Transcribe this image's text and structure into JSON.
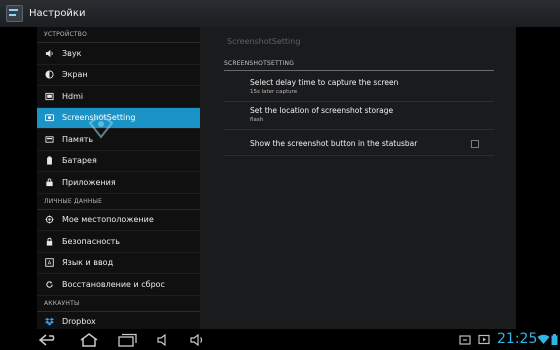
{
  "app": {
    "title": "Настройки",
    "icon": "settings-app-icon"
  },
  "sidebar": {
    "sections": [
      {
        "label": "УСТРОЙСТВО",
        "items": [
          {
            "label": "Звук",
            "icon": "volume-icon"
          },
          {
            "label": "Экран",
            "icon": "brightness-icon"
          },
          {
            "label": "Hdmi",
            "icon": "hdmi-icon"
          },
          {
            "label": "ScreenshotSetting",
            "icon": "camera-icon",
            "selected": true
          },
          {
            "label": "Память",
            "icon": "storage-icon"
          },
          {
            "label": "Батарея",
            "icon": "battery-icon"
          },
          {
            "label": "Приложения",
            "icon": "apps-icon"
          }
        ]
      },
      {
        "label": "ЛИЧНЫЕ ДАННЫЕ",
        "items": [
          {
            "label": "Мое местоположение",
            "icon": "location-icon"
          },
          {
            "label": "Безопасность",
            "icon": "lock-icon"
          },
          {
            "label": "Язык и ввод",
            "icon": "language-icon"
          },
          {
            "label": "Восстановление и сброс",
            "icon": "backup-icon"
          }
        ]
      },
      {
        "label": "АККАУНТЫ",
        "items": [
          {
            "label": "Dropbox",
            "icon": "dropbox-icon"
          }
        ]
      }
    ]
  },
  "detail": {
    "breadcrumb": "ScreenshotSetting",
    "section": "SCREENSHOTSETTING",
    "prefs": [
      {
        "title": "Select delay time to capture the screen",
        "summary": "15s later capture"
      },
      {
        "title": "Set the location of screenshot storage",
        "summary": "flash"
      },
      {
        "title": "Show the screenshot button in the statusbar",
        "summary": "",
        "checked": false
      }
    ]
  },
  "statusbar": {
    "time": "21:25"
  },
  "colors": {
    "accent": "#1c93c7",
    "clock": "#31b4e8"
  }
}
